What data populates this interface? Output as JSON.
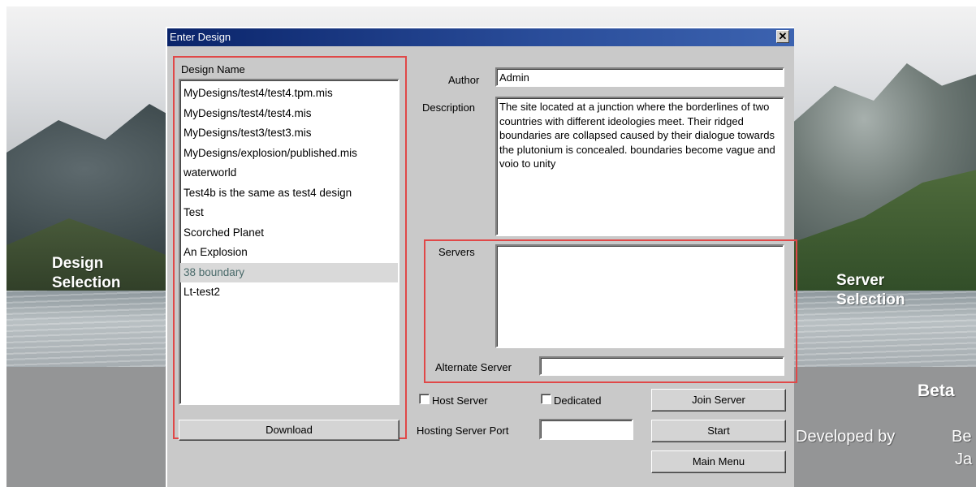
{
  "background": {
    "left_label_line1": "Design",
    "left_label_line2": "Selection",
    "right_label_line1": "Server",
    "right_label_line2": "Selection",
    "beta": "Beta",
    "developed_by": "Developed by",
    "credit_line1": "Be",
    "credit_line2": "Ja"
  },
  "dialog": {
    "title": "Enter Design",
    "close_glyph": "✕",
    "design_name_label": "Design Name",
    "designs": [
      "MyDesigns/test4/test4.tpm.mis",
      "MyDesigns/test4/test4.mis",
      "MyDesigns/test3/test3.mis",
      "MyDesigns/explosion/published.mis",
      "waterworld",
      "Test4b is the same as test4 design",
      "Test",
      "Scorched Planet",
      "An Explosion",
      "38 boundary",
      "Lt-test2"
    ],
    "selected_index": 9,
    "download_label": "Download",
    "author_label": "Author",
    "author_value": "Admin",
    "description_label": "Description",
    "description_value": "The site located at a junction where the borderlines of two countries with different ideologies meet. Their ridged boundaries are collapsed caused by their dialogue towards the plutonium is concealed.  boundaries become vague and  voio to unity",
    "servers_label": "Servers",
    "alternate_server_label": "Alternate Server",
    "alternate_server_value": "",
    "host_server_label": "Host Server",
    "dedicated_label": "Dedicated",
    "hosting_port_label": "Hosting Server Port",
    "hosting_port_value": "",
    "join_server_label": "Join Server",
    "start_label": "Start",
    "main_menu_label": "Main Menu"
  }
}
